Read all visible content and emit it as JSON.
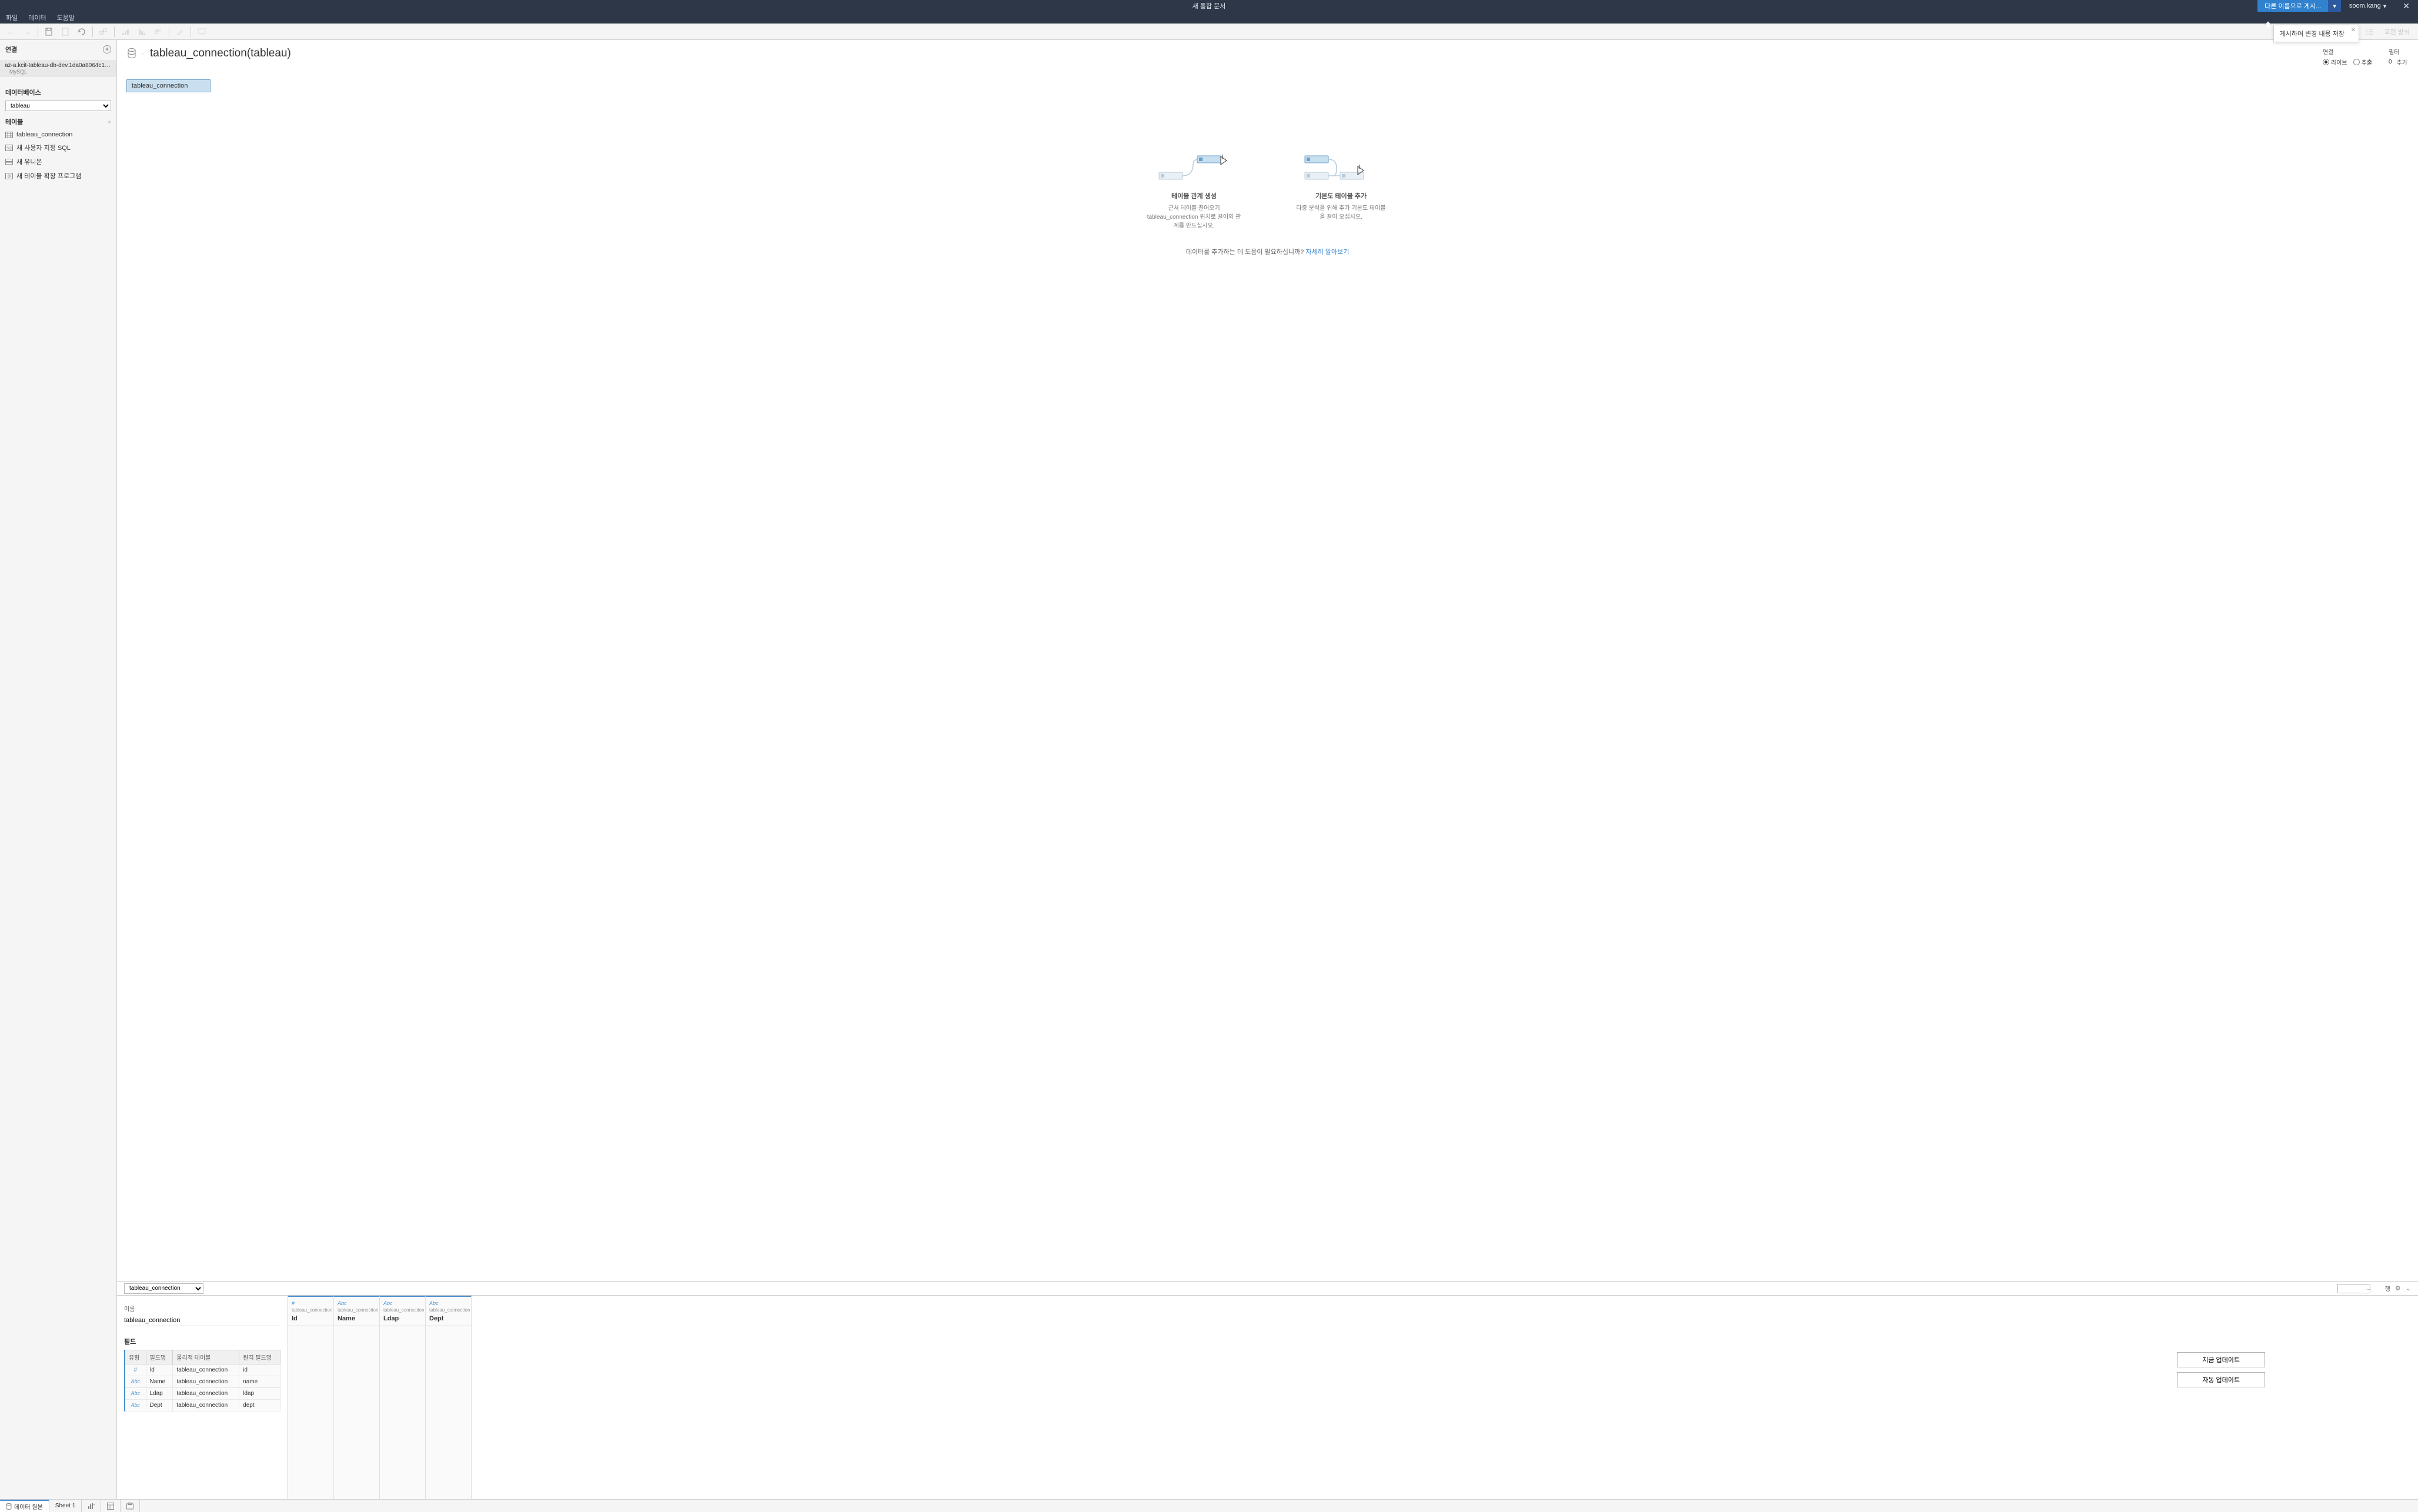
{
  "window_title": "새 통합 문서",
  "publish_button": "다른 이름으로 게시...",
  "user_name": "soom.kang",
  "menu": [
    "파일",
    "데이터",
    "도움말"
  ],
  "tooltip": "게시하여 변경 내용 저장",
  "format_button": "표현 방식",
  "sidebar": {
    "connections_header": "연결",
    "connection": {
      "name": "az-a.kcit-tableau-db-dev.1da0a8064c18...",
      "type": "MySQL"
    },
    "database_header": "데이터베이스",
    "database_value": "tableau",
    "tables_header": "테이블",
    "table_items": [
      {
        "icon": "grid",
        "label": "tableau_connection"
      },
      {
        "icon": "sql",
        "label": "새 사용자 지정 SQL"
      },
      {
        "icon": "union",
        "label": "새 유니온"
      },
      {
        "icon": "ext",
        "label": "새 테이블 확장 프로그램"
      }
    ]
  },
  "canvas": {
    "title": "tableau_connection(tableau)",
    "connection_mode_label": "연결",
    "live_label": "라이브",
    "extract_label": "추출",
    "filter_label": "필터",
    "filter_count": "0",
    "filter_add": "추가",
    "pill_label": "tableau_connection",
    "illust1_title": "테이블 관계 생성",
    "illust1_desc": "근처 테이블 끌어오기 tableau_connection 위치로 끌어와 관계를 만드십시오.",
    "illust2_title": "기본도 테이블 추가",
    "illust2_desc": "다중 분석을 위해 추가 기본도 테이블을 끌어 오십시오.",
    "help_text": "데이터를 추가하는 데 도움이 필요하십니까? ",
    "help_link": "자세히 알아보기"
  },
  "grid": {
    "table_select": "tableau_connection",
    "rows_label": "행",
    "name_label": "이름",
    "name_value": "tableau_connection",
    "fields_label": "필드",
    "field_headers": [
      "유형",
      "필드명",
      "물리적 테이블",
      "원격 필드명"
    ],
    "fields": [
      {
        "type": "#",
        "name": "Id",
        "table": "tableau_connection",
        "remote": "id"
      },
      {
        "type": "Abc",
        "name": "Name",
        "table": "tableau_connection",
        "remote": "name"
      },
      {
        "type": "Abc",
        "name": "Ldap",
        "table": "tableau_connection",
        "remote": "ldap"
      },
      {
        "type": "Abc",
        "name": "Dept",
        "table": "tableau_connection",
        "remote": "dept"
      }
    ],
    "preview_columns": [
      {
        "type": "#",
        "source": "tableau_connection",
        "name": "Id"
      },
      {
        "type": "Abc",
        "source": "tableau_connection",
        "name": "Name"
      },
      {
        "type": "Abc",
        "source": "tableau_connection",
        "name": "Ldap"
      },
      {
        "type": "Abc",
        "source": "tableau_connection",
        "name": "Dept"
      }
    ],
    "update_now": "지금 업데이트",
    "auto_update": "자동 업데이트"
  },
  "tabs": {
    "data_source": "데이터 원본",
    "sheet1": "Sheet 1"
  }
}
